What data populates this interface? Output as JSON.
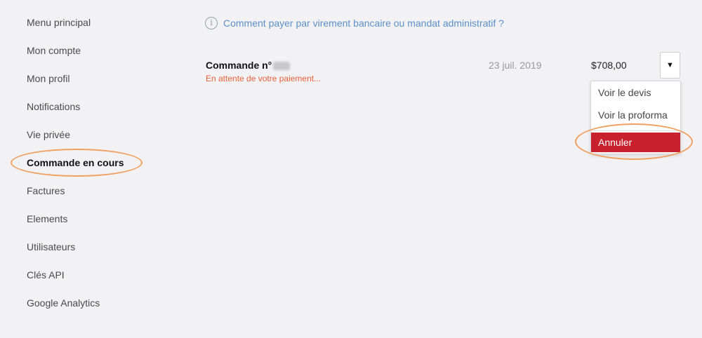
{
  "sidebar": {
    "items": [
      {
        "label": "Menu principal"
      },
      {
        "label": "Mon compte"
      },
      {
        "label": "Mon profil"
      },
      {
        "label": "Notifications"
      },
      {
        "label": "Vie privée"
      },
      {
        "label": "Commande en cours",
        "active": true
      },
      {
        "label": "Factures"
      },
      {
        "label": "Elements"
      },
      {
        "label": "Utilisateurs"
      },
      {
        "label": "Clés API"
      },
      {
        "label": "Google Analytics"
      }
    ]
  },
  "help": {
    "icon": "info-icon",
    "icon_glyph": "i",
    "text": "Comment payer par virement bancaire ou mandat administratif ?"
  },
  "order": {
    "title": "Commande n°",
    "status": "En attente de votre paiement...",
    "date": "23 juil. 2019",
    "price": "$708,00",
    "dropdown_glyph": "▼"
  },
  "menu": {
    "view_quote": "Voir le devis",
    "view_proforma": "Voir la proforma",
    "cancel": "Annuler"
  },
  "colors": {
    "accent_link": "#5b8fc7",
    "status_pending": "#e8603c",
    "danger": "#c8202c",
    "highlight": "#f0a060",
    "background": "#f2f2f4"
  }
}
